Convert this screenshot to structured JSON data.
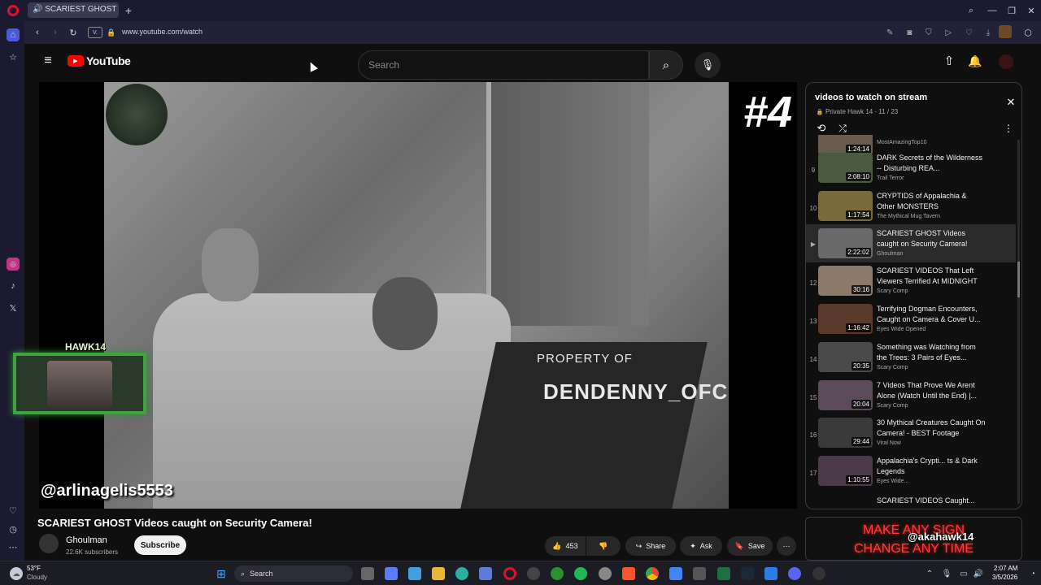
{
  "browser": {
    "tab_title": "SCARIEST GHOST Vid...",
    "url": "www.youtube.com/watch",
    "address_extra": "V."
  },
  "youtube": {
    "logo_text": "YouTube",
    "search_placeholder": "Search"
  },
  "player": {
    "badge": "#4",
    "watermark_line1": "PROPERTY OF",
    "watermark_line2": "DENDENNY_OFC",
    "overlay_handle": "@arlinagelis5553",
    "streamer_name": "HAWK14"
  },
  "video": {
    "title": "SCARIEST GHOST Videos caught on Security Camera!",
    "channel": "Ghoulman",
    "subscribers": "22.6K subscribers",
    "subscribe_label": "Subscribe",
    "likes": "453",
    "share_label": "Share",
    "ask_label": "Ask",
    "save_label": "Save"
  },
  "playlist": {
    "title": "videos to watch on stream",
    "owner_line": "Private Hawk 14 · 11 / 23",
    "items": [
      {
        "index": "",
        "title": "",
        "channel": "MostAmazingTop10",
        "duration": "1:24:14"
      },
      {
        "index": "9",
        "title": "DARK Secrets of the Wilderness -- Disturbing REA...",
        "channel": "Trail Terror",
        "duration": "2:08:10"
      },
      {
        "index": "10",
        "title": "CRYPTIDS of Appalachia & Other MONSTERS",
        "channel": "The Mythical Mug Tavern",
        "duration": "1:17:54"
      },
      {
        "index": "▶",
        "title": "SCARIEST GHOST Videos caught on Security Camera!",
        "channel": "Ghoulman",
        "duration": "2:22:02"
      },
      {
        "index": "12",
        "title": "SCARIEST VIDEOS That Left Viewers Terrified At MIDNIGHT",
        "channel": "Scary Comp",
        "duration": "30:16"
      },
      {
        "index": "13",
        "title": "Terrifying Dogman Encounters, Caught on Camera & Cover U...",
        "channel": "Eyes Wide Opened",
        "duration": "1:16:42"
      },
      {
        "index": "14",
        "title": "Something was Watching from the Trees: 3 Pairs of Eyes...",
        "channel": "Scary Comp",
        "duration": "20:35"
      },
      {
        "index": "15",
        "title": "7 Videos That Prove We Arent Alone (Watch Until the End) |...",
        "channel": "Scary Comp",
        "duration": "20:04"
      },
      {
        "index": "16",
        "title": "30 Mythical Creatures Caught On Camera! - BEST Footage",
        "channel": "Viral Now",
        "duration": "29:44"
      },
      {
        "index": "17",
        "title": "Appalachia's Crypti... ts & Dark Legends",
        "channel": "Eyes Wide...",
        "duration": "1:10:55"
      }
    ],
    "next_peek": "SCARIEST VIDEOS Caught..."
  },
  "overlay": {
    "banner_line1": "MAKE ANY SIGN",
    "banner_line2": "CHANGE ANY TIME",
    "social_handle": "@akahawk14"
  },
  "taskbar": {
    "weather_temp": "53°F",
    "weather_desc": "Cloudy",
    "search_label": "Search",
    "time": "2:07 AM",
    "date": "3/5/2026"
  },
  "colors": {
    "yt_red": "#ff0000",
    "opera_red": "#e0102c",
    "banner_red": "#ff3b3b",
    "streamer_green": "#3fa43f"
  }
}
